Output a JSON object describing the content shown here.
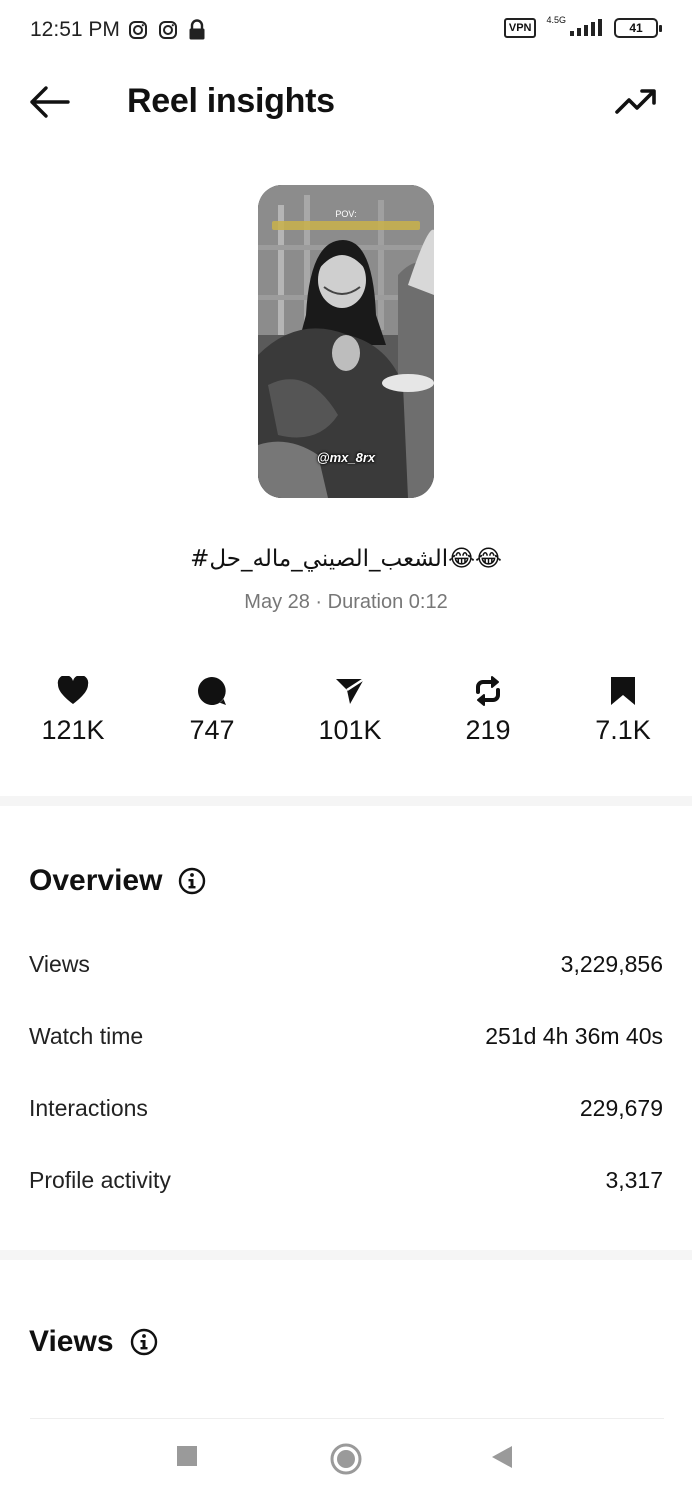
{
  "status": {
    "time": "12:51 PM",
    "vpn": "VPN",
    "network": "4.5G",
    "battery": "41"
  },
  "header": {
    "title": "Reel insights"
  },
  "reel": {
    "thumb_pov": "POV:",
    "thumb_watermark": "@mx_8rx",
    "caption": "#الشعب_الصيني_ماله_حل😂😂",
    "meta": "May 28 · Duration 0:12"
  },
  "stats": {
    "likes": "121K",
    "comments": "747",
    "shares": "101K",
    "reposts": "219",
    "saves": "7.1K"
  },
  "overview": {
    "title": "Overview",
    "rows": [
      {
        "label": "Views",
        "value": "3,229,856"
      },
      {
        "label": "Watch time",
        "value": "251d 4h 36m 40s"
      },
      {
        "label": "Interactions",
        "value": "229,679"
      },
      {
        "label": "Profile activity",
        "value": "3,317"
      }
    ]
  },
  "views_section": {
    "title": "Views"
  },
  "icons": {
    "back": "back-arrow-icon",
    "trend": "trending-up-icon",
    "likes": "heart-icon",
    "comments": "comment-bubble-icon",
    "shares": "send-icon",
    "reposts": "repost-icon",
    "saves": "bookmark-icon",
    "info": "info-icon"
  }
}
